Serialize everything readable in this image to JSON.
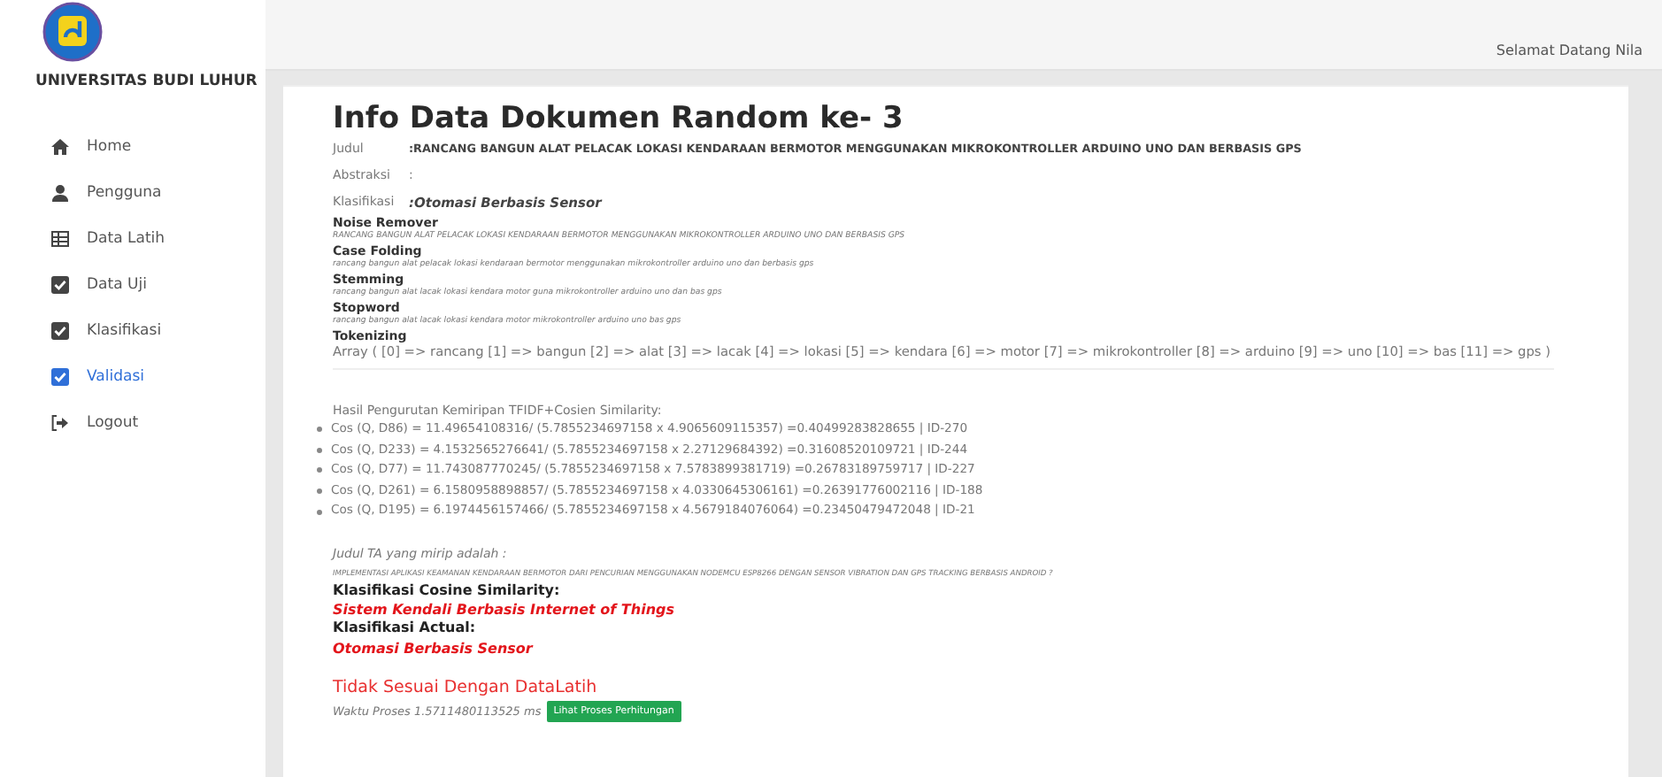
{
  "sidebar": {
    "brand": "UNIVERSITAS BUDI LUHUR",
    "items": [
      {
        "label": "Home",
        "selected": false
      },
      {
        "label": "Pengguna",
        "selected": false
      },
      {
        "label": "Data Latih",
        "selected": false
      },
      {
        "label": "Data Uji",
        "selected": false
      },
      {
        "label": "Klasifikasi",
        "selected": false
      },
      {
        "label": "Validasi",
        "selected": true
      },
      {
        "label": "Logout",
        "selected": false
      }
    ]
  },
  "header": {
    "greeting": "Selamat Datang Nila"
  },
  "title": "Info Data Dokumen Random ke- 3",
  "fields": [
    {
      "label": "Judul",
      "value": ":RANCANG BANGUN ALAT PELACAK LOKASI KENDARAAN BERMOTOR MENGGUNAKAN MIKROKONTROLLER ARDUINO UNO DAN BERBASIS GPS",
      "kind": "bold"
    },
    {
      "label": "Abstraksi",
      "value": ":",
      "kind": "plain"
    },
    {
      "label": "Klasifikasi",
      "value": ":Otomasi Berbasis Sensor",
      "kind": "bolditalic"
    }
  ],
  "steps": [
    {
      "heading": "Noise Remover",
      "text": "RANCANG BANGUN ALAT PELACAK LOKASI KENDARAAN BERMOTOR MENGGUNAKAN MIKROKONTROLLER ARDUINO UNO DAN BERBASIS GPS",
      "kind": "small"
    },
    {
      "heading": "Case Folding",
      "text": "rancang bangun alat pelacak lokasi kendaraan bermotor menggunakan mikrokontroller arduino uno dan berbasis gps",
      "kind": "small"
    },
    {
      "heading": "Stemming",
      "text": "rancang bangun alat lacak lokasi kendara motor guna mikrokontroller arduino uno dan bas gps",
      "kind": "small"
    },
    {
      "heading": "Stopword",
      "text": "rancang bangun alat lacak lokasi kendara motor mikrokontroller arduino uno bas gps",
      "kind": "small"
    },
    {
      "heading": "Tokenizing",
      "text": "Array ( [0] => rancang [1] => bangun [2] => alat [3] => lacak [4] => lokasi [5] => kendara [6] => motor [7] => mikrokontroller [8] => arduino [9] => uno [10] => bas [11] => gps )",
      "kind": "normal"
    }
  ],
  "ranking": {
    "title": "Hasil Pengurutan Kemiripan TFIDF+Cosien Similarity:",
    "items": [
      "Cos (Q, D86) = 11.49654108316/ (5.7855234697158 x 4.9065609115357) =0.40499283828655 | ID-270",
      "Cos (Q, D233) = 4.1532565276641/ (5.7855234697158 x 2.27129684392) =0.31608520109721 | ID-244",
      "Cos (Q, D77) = 11.743087770245/ (5.7855234697158 x 7.5783899381719) =0.26783189759717 | ID-227",
      "Cos (Q, D261) = 6.1580958898857/ (5.7855234697158 x 4.0330645306161) =0.26391776002116 | ID-188",
      "Cos (Q, D195) = 6.1974456157466/ (5.7855234697158 x 4.5679184076064) =0.23450479472048 | ID-21"
    ]
  },
  "result": {
    "similar_label": "Judul TA yang mirip adalah :",
    "similar_title": "IMPLEMENTASI APLIKASI KEAMANAN KENDARAAN BERMOTOR DARI PENCURIAN MENGGUNAKAN NODEMCU ESP8266 DENGAN SENSOR VIBRATION DAN GPS TRACKING BERBASIS ANDROID ?",
    "cosine_label": "Klasifikasi Cosine Similarity:",
    "cosine_value": "Sistem Kendali Berbasis Internet of Things",
    "actual_label": "Klasifikasi Actual:",
    "actual_value": "Otomasi Berbasis Sensor",
    "verdict": "Tidak Sesuai Dengan DataLatih",
    "time": "Waktu Proses 1.5711480113525 ms",
    "button": "Lihat Proses Perhitungan"
  }
}
